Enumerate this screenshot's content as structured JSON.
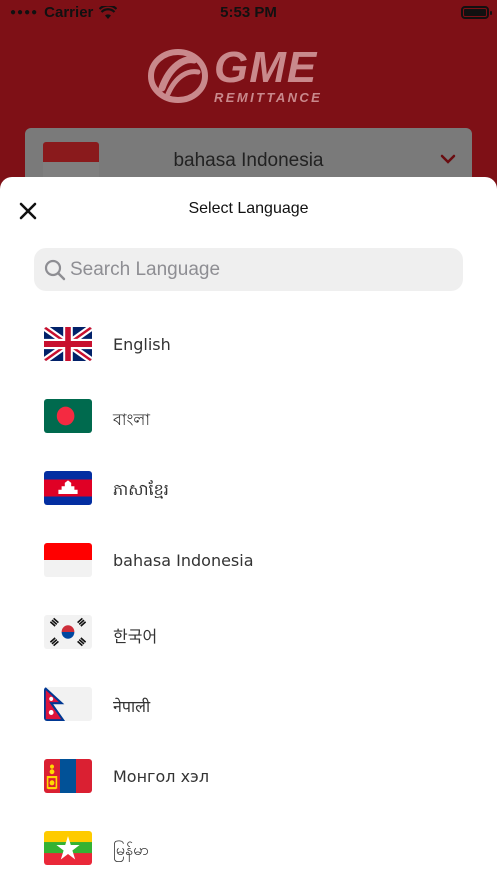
{
  "status_bar": {
    "carrier": "Carrier",
    "time": "5:53 PM"
  },
  "background": {
    "logo_main": "GME",
    "logo_sub": "REMITTANCE",
    "selected_language": "bahasa Indonesia"
  },
  "sheet": {
    "title": "Select Language",
    "search_placeholder": "Search Language",
    "languages": [
      {
        "label": "English",
        "flag": "uk-flag-icon"
      },
      {
        "label": "বাংলা",
        "flag": "bangladesh-flag-icon"
      },
      {
        "label": "ភាសាខ្មែរ",
        "flag": "cambodia-flag-icon"
      },
      {
        "label": "bahasa Indonesia",
        "flag": "indonesia-flag-icon"
      },
      {
        "label": "한국어",
        "flag": "korea-flag-icon"
      },
      {
        "label": "नेपाली",
        "flag": "nepal-flag-icon"
      },
      {
        "label": "Монгол хэл",
        "flag": "mongolia-flag-icon"
      },
      {
        "label": "မြန်မာ",
        "flag": "myanmar-flag-icon"
      }
    ]
  },
  "colors": {
    "brand_red": "#7e1016",
    "sheet_bg": "#ffffff",
    "search_bg": "#efefef"
  }
}
